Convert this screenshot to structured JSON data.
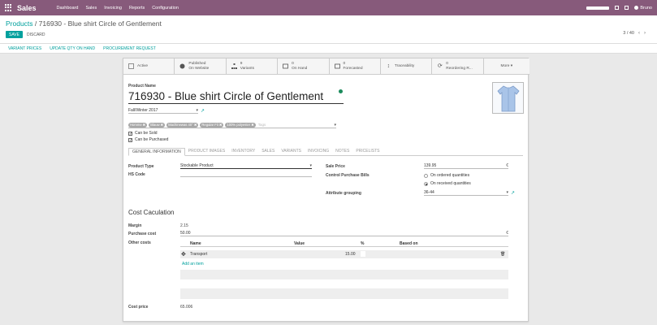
{
  "topbar": {
    "app_title": "Sales",
    "menu": [
      "Dashboard",
      "Sales",
      "Invoicing",
      "Reports",
      "Configuration"
    ],
    "user": "Bruno"
  },
  "control_panel": {
    "breadcrumb_parent": "Products",
    "breadcrumb_sep": "/",
    "breadcrumb_current": "716930 - Blue shirt Circle of Gentlement",
    "save_label": "SAVE",
    "discard_label": "DISCARD",
    "pager": "3 / 40"
  },
  "action_bar": [
    "VARIANT PRICES",
    "UPDATE QTY ON HAND",
    "PROCUREMENT REQUEST"
  ],
  "smart_buttons": [
    {
      "l1": "",
      "l2": "Active"
    },
    {
      "l1": "Published",
      "l2": "On Website"
    },
    {
      "l1": "9",
      "l2": "Variants"
    },
    {
      "l1": "0",
      "l2": "On Hand"
    },
    {
      "l1": "0",
      "l2": "Forecasted"
    },
    {
      "l1": "",
      "l2": "Traceability"
    },
    {
      "l1": "0",
      "l2": "Reordering R..."
    },
    {
      "l1": "",
      "l2": "More ▾"
    }
  ],
  "product": {
    "name_label": "Product Name",
    "name": "716930 - Blue shirt Circle of Gentlement",
    "season": "Fall/Winter 2017",
    "tags": [
      "Homme",
      "Blauw",
      "Machinewas 40°",
      "Regular Fit",
      "100% polyester"
    ],
    "tags_placeholder": "Tags",
    "can_be_sold": "Can be Sold",
    "can_be_purchased": "Can be Purchased"
  },
  "tabs": [
    "GENERAL INFORMATION",
    "PRODUCT IMAGES",
    "INVENTORY",
    "SALES",
    "VARIANTS",
    "INVOICING",
    "NOTES",
    "PRICELISTS"
  ],
  "general": {
    "product_type_label": "Product Type",
    "product_type": "Stockable Product",
    "hs_code_label": "HS Code",
    "sale_price_label": "Sale Price",
    "sale_price": "139.95",
    "control_bills_label": "Control Purchase Bills",
    "opt_ordered": "On ordered quantities",
    "opt_received": "On received quantities",
    "attr_grouping_label": "Attribute grouping",
    "attr_grouping": "36-44"
  },
  "cost": {
    "title": "Cost Caculation",
    "margin_label": "Margin",
    "margin": "2.15",
    "purchase_cost_label": "Purchase cost",
    "purchase_cost": "50.00",
    "other_costs_label": "Other costs",
    "headers": [
      "Name",
      "Value",
      "%",
      "Based on"
    ],
    "rows": [
      {
        "name": "Transport",
        "value": "15.00"
      }
    ],
    "add_item": "Add an item",
    "cost_price_label": "Cost price",
    "cost_price": "65.006"
  }
}
